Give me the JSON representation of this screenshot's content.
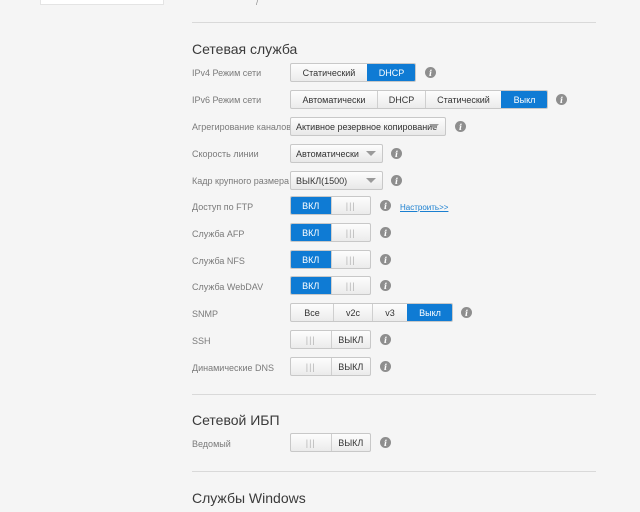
{
  "top_fragment": "/",
  "network_service": {
    "title": "Сетевая служба",
    "ipv4": {
      "label": "IPv4 Режим сети",
      "options": [
        "Статический",
        "DHCP"
      ],
      "selected": "DHCP"
    },
    "ipv6": {
      "label": "IPv6 Режим сети",
      "options": [
        "Автоматически",
        "DHCP",
        "Статический",
        "Выкл"
      ],
      "selected": "Выкл"
    },
    "aggregation": {
      "label": "Агрегирование каналов",
      "value": "Активное резервное копирование"
    },
    "link_speed": {
      "label": "Скорость линии",
      "value": "Автоматически"
    },
    "jumbo_frame": {
      "label": "Кадр крупного размера",
      "value": "ВЫКЛ(1500)"
    },
    "ftp": {
      "label": "Доступ по FTP",
      "state": "ВКЛ",
      "on": true,
      "link": "Настроить>>"
    },
    "afp": {
      "label": "Служба AFP",
      "state": "ВКЛ",
      "on": true
    },
    "nfs": {
      "label": "Служба NFS",
      "state": "ВКЛ",
      "on": true
    },
    "webdav": {
      "label": "Служба WebDAV",
      "state": "ВКЛ",
      "on": true
    },
    "snmp": {
      "label": "SNMP",
      "options": [
        "Все",
        "v2c",
        "v3",
        "Выкл"
      ],
      "selected": "Выкл"
    },
    "ssh": {
      "label": "SSH",
      "state": "ВЫКЛ",
      "on": false
    },
    "ddns": {
      "label": "Динамические DNS",
      "state": "ВЫКЛ",
      "on": false
    }
  },
  "ups": {
    "title": "Сетевой ИБП",
    "slave": {
      "label": "Ведомый",
      "state": "ВЫКЛ",
      "on": false
    }
  },
  "windows": {
    "title": "Службы Windows"
  },
  "grip": "|||",
  "info_glyph": "i",
  "colors": {
    "accent": "#0f7bd4",
    "link": "#1a7fd0",
    "label": "#7a7a7a"
  }
}
